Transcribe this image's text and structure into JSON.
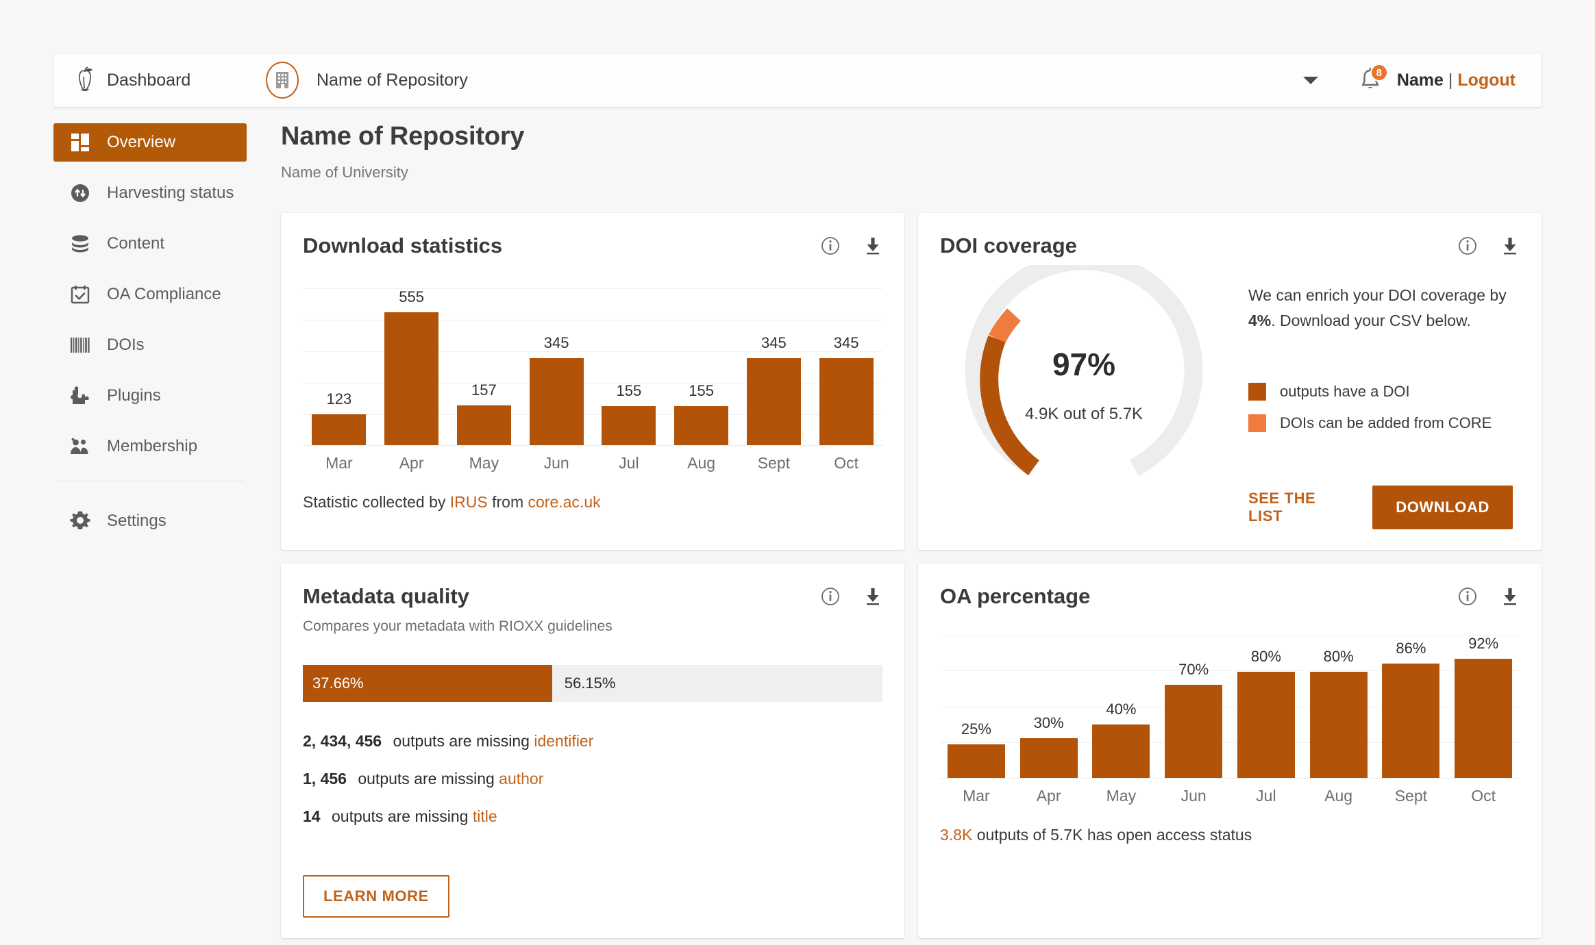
{
  "topbar": {
    "dashboard_label": "Dashboard",
    "repository_name": "Name of Repository",
    "notification_count": "8",
    "user_name": "Name",
    "separator": "|",
    "logout_label": "Logout"
  },
  "sidebar": {
    "items": [
      {
        "label": "Overview",
        "icon": "grid-icon",
        "active": true
      },
      {
        "label": "Harvesting status",
        "icon": "sync-icon",
        "active": false
      },
      {
        "label": "Content",
        "icon": "database-icon",
        "active": false
      },
      {
        "label": "OA Compliance",
        "icon": "calendar-check-icon",
        "active": false
      },
      {
        "label": "DOIs",
        "icon": "barcode-icon",
        "active": false
      },
      {
        "label": "Plugins",
        "icon": "puzzle-icon",
        "active": false
      },
      {
        "label": "Membership",
        "icon": "people-icon",
        "active": false
      }
    ],
    "settings": {
      "label": "Settings",
      "icon": "gear-icon"
    }
  },
  "header": {
    "title": "Name of Repository",
    "subtitle": "Name of University"
  },
  "colors": {
    "brand_orange": "#b35309",
    "brand_orange_light": "#f07b3f",
    "link_orange": "#c1621a",
    "track_grey": "#ececec",
    "page_bg": "#f7f7f7"
  },
  "cards": {
    "download_statistics": {
      "title": "Download statistics",
      "footer_prefix": "Statistic collected by ",
      "footer_link1": "IRUS",
      "footer_middle": " from ",
      "footer_link2": "core.ac.uk",
      "info_icon": "info-icon",
      "download_icon": "download-icon"
    },
    "doi_coverage": {
      "title": "DOI coverage",
      "percent_label": "97%",
      "count_label": "4.9K out of 5.7K",
      "message_prefix": "We can enrich your DOI coverage by ",
      "message_bold": "4%",
      "message_suffix": ". Download your CSV below.",
      "legend": [
        {
          "color": "#b35309",
          "label": "outputs have a DOI"
        },
        {
          "color": "#f07b3f",
          "label": "DOIs can be added from CORE"
        }
      ],
      "see_list_label": "SEE THE LIST",
      "download_label": "DOWNLOAD",
      "info_icon": "info-icon",
      "download_icon": "download-icon"
    },
    "metadata_quality": {
      "title": "Metadata quality",
      "subtitle": "Compares your metadata with RIOXX guidelines",
      "bar_left_label": "37.66%",
      "bar_right_label": "56.15%",
      "missing": [
        {
          "count": "2, 434, 456",
          "text": " outputs are missing ",
          "field": "identifier"
        },
        {
          "count": "1, 456",
          "text": " outputs are missing ",
          "field": "author"
        },
        {
          "count": "14",
          "text": " outputs are missing ",
          "field": "title"
        }
      ],
      "learn_more_label": "LEARN MORE",
      "info_icon": "info-icon",
      "download_icon": "download-icon"
    },
    "oa_percentage": {
      "title": "OA percentage",
      "footer_highlight": "3.8K",
      "footer_text": " outputs of 5.7K has open access status",
      "info_icon": "info-icon",
      "download_icon": "download-icon"
    }
  },
  "chart_data": [
    {
      "type": "bar",
      "title": "Download statistics",
      "categories": [
        "Mar",
        "Apr",
        "May",
        "Jun",
        "Jul",
        "Aug",
        "Sept",
        "Oct"
      ],
      "values": [
        123,
        555,
        157,
        345,
        155,
        155,
        345,
        345
      ],
      "labels": [
        "123",
        "555",
        "157",
        "345",
        "155",
        "155",
        "345",
        "345"
      ],
      "xlabel": "",
      "ylabel": "",
      "ylim": [
        0,
        620
      ],
      "grid": true,
      "legend": "none",
      "color": "#b35309"
    },
    {
      "type": "bar",
      "title": "OA percentage",
      "categories": [
        "Mar",
        "Apr",
        "May",
        "Jun",
        "Jul",
        "Aug",
        "Sept",
        "Oct"
      ],
      "values": [
        25,
        30,
        40,
        70,
        80,
        80,
        86,
        92
      ],
      "labels": [
        "25%",
        "30%",
        "40%",
        "70%",
        "80%",
        "80%",
        "86%",
        "92%"
      ],
      "xlabel": "",
      "ylabel": "",
      "ylim": [
        0,
        108
      ],
      "grid": true,
      "legend": "none",
      "color": "#b35309"
    },
    {
      "type": "pie",
      "title": "DOI coverage",
      "variant": "gauge-donut",
      "center_label": "97%",
      "center_sublabel": "4.9K out of 5.7K",
      "slices": [
        {
          "name": "outputs have a DOI",
          "value": 93,
          "color": "#b35309"
        },
        {
          "name": "DOIs can be added from CORE",
          "value": 7,
          "color": "#f07b3f"
        },
        {
          "name": "remaining",
          "value": 220,
          "color": "#ededed"
        }
      ]
    },
    {
      "type": "bar",
      "title": "Metadata quality",
      "variant": "stacked-horizontal",
      "categories": [
        "Metadata quality"
      ],
      "series": [
        {
          "name": "37.66%",
          "values": [
            37.66
          ],
          "color": "#b35309"
        },
        {
          "name": "56.15%",
          "values": [
            56.15
          ],
          "color": "#efefef"
        }
      ],
      "labels": [
        "37.66%",
        "56.15%"
      ]
    }
  ]
}
